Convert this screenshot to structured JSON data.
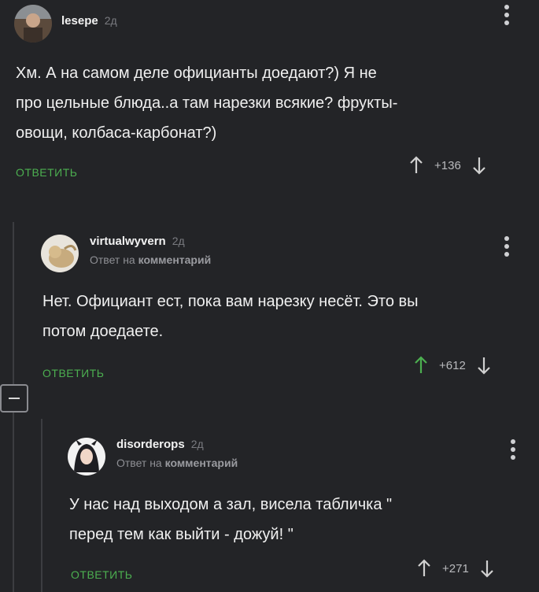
{
  "comments": [
    {
      "username": "lesepe",
      "time": "2д",
      "body": [
        "Хм. А на самом деле официанты доедают?) Я не",
        "про цельные блюда..а там нарезки всякие? фрукты-",
        "овощи, колбаса-карбонат?)"
      ],
      "reply_label": "ОТВЕТИТЬ",
      "rating": "+136"
    },
    {
      "username": "virtualwyvern",
      "time": "2д",
      "reply_prefix": "Ответ на",
      "reply_target": "комментарий",
      "body": [
        "Нет. Официант ест, пока вам нарезку несёт. Это вы",
        "потом доедаете."
      ],
      "reply_label": "ОТВЕТИТЬ",
      "rating": "+612"
    },
    {
      "username": "disorderops",
      "time": "2д",
      "reply_prefix": "Ответ на",
      "reply_target": "комментарий",
      "body": [
        "У нас над выходом а зал, висела табличка \"",
        "перед тем как выйти - дожуй! \""
      ],
      "reply_label": "ОТВЕТИТЬ",
      "rating": "+271"
    }
  ],
  "colors": {
    "background": "#232427",
    "accent": "#4caf50",
    "text": "#f0f0f0"
  }
}
